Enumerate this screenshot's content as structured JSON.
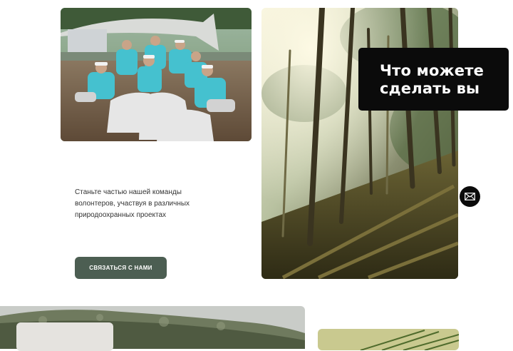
{
  "section": {
    "heading": "Что можете сделать вы",
    "description": "Станьте частью нашей команды волонтеров, участвуя в различных природоохранных проектах",
    "cta_label": "СВЯЗАТЬСЯ С НАМИ"
  },
  "icons": {
    "mail": "envelope-icon"
  },
  "colors": {
    "cta_background": "#4c5e52",
    "heading_card_background": "#0b0b0b",
    "page_background": "#ffffff"
  }
}
